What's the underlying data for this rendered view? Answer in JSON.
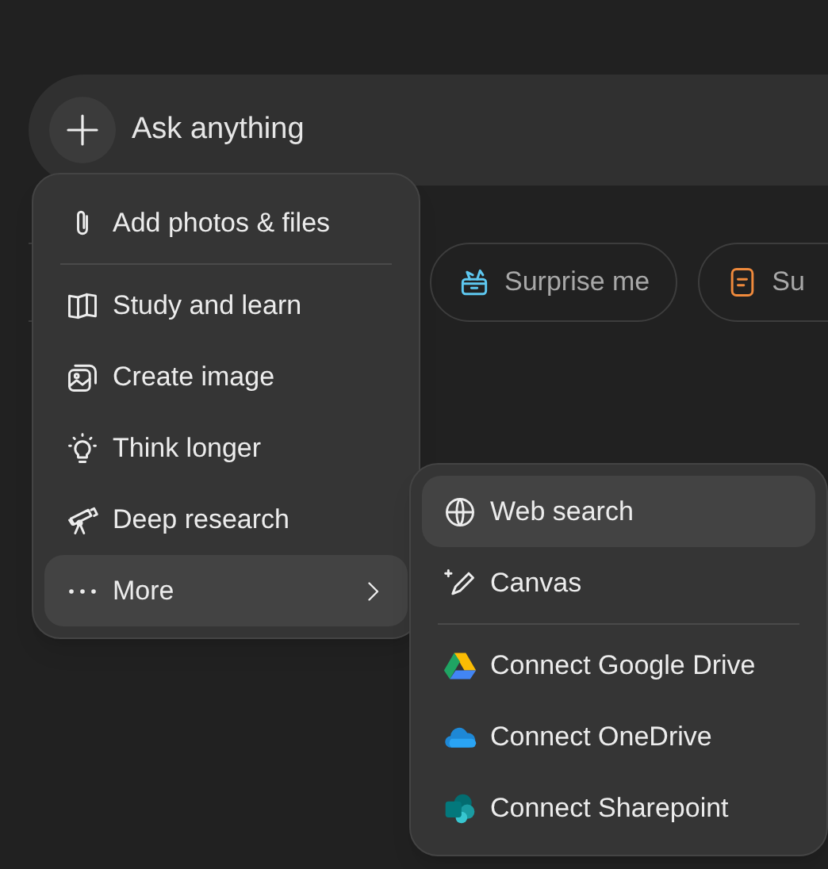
{
  "prompt": {
    "placeholder": "Ask anything"
  },
  "suggestions": [
    {
      "kind": "covered"
    },
    {
      "kind": "gift",
      "label": "Surprise me"
    },
    {
      "kind": "document",
      "label": "Su"
    }
  ],
  "menu": {
    "items": [
      {
        "kind": "item",
        "label": "Add photos & files",
        "selected": false,
        "submenu": false
      },
      {
        "kind": "divider"
      },
      {
        "kind": "item",
        "label": "Study and learn",
        "selected": false,
        "submenu": false
      },
      {
        "kind": "item",
        "label": "Create image",
        "selected": false,
        "submenu": false
      },
      {
        "kind": "item",
        "label": "Think longer",
        "selected": false,
        "submenu": false
      },
      {
        "kind": "item",
        "label": "Deep research",
        "selected": false,
        "submenu": false
      },
      {
        "kind": "item",
        "label": "More",
        "selected": true,
        "submenu": true
      }
    ]
  },
  "submenu": {
    "items": [
      {
        "kind": "item",
        "label": "Web search",
        "selected": true
      },
      {
        "kind": "item",
        "label": "Canvas",
        "selected": false
      },
      {
        "kind": "divider"
      },
      {
        "kind": "item",
        "label": "Connect Google Drive",
        "selected": false
      },
      {
        "kind": "item",
        "label": "Connect OneDrive",
        "selected": false
      },
      {
        "kind": "item",
        "label": "Connect Sharepoint",
        "selected": false
      }
    ]
  }
}
